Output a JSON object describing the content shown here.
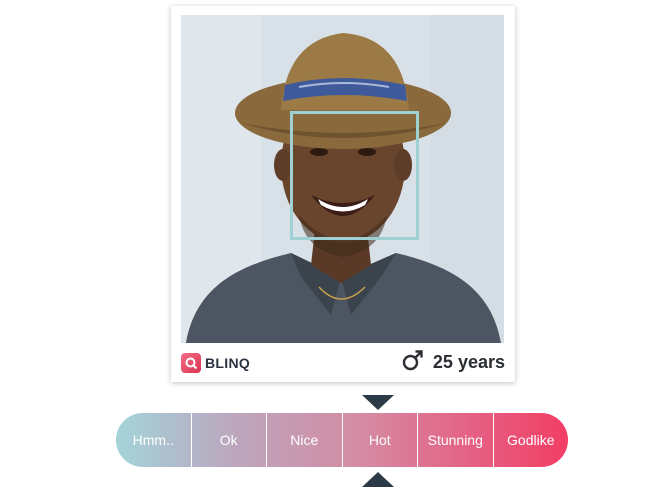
{
  "profile": {
    "brand_name": "BLINQ",
    "brand_icon": "blinq-logo-icon",
    "gender_icon": "male-symbol-icon",
    "age_text": "25 years"
  },
  "rating": {
    "options": [
      "Hmm..",
      "Ok",
      "Nice",
      "Hot",
      "Stunning",
      "Godlike"
    ],
    "selected": "Hot"
  },
  "colors": {
    "scale_start": "#a3d4d9",
    "scale_end": "#f23e64",
    "face_frame": "#9fd0d4",
    "pointer": "#2c3a48"
  }
}
